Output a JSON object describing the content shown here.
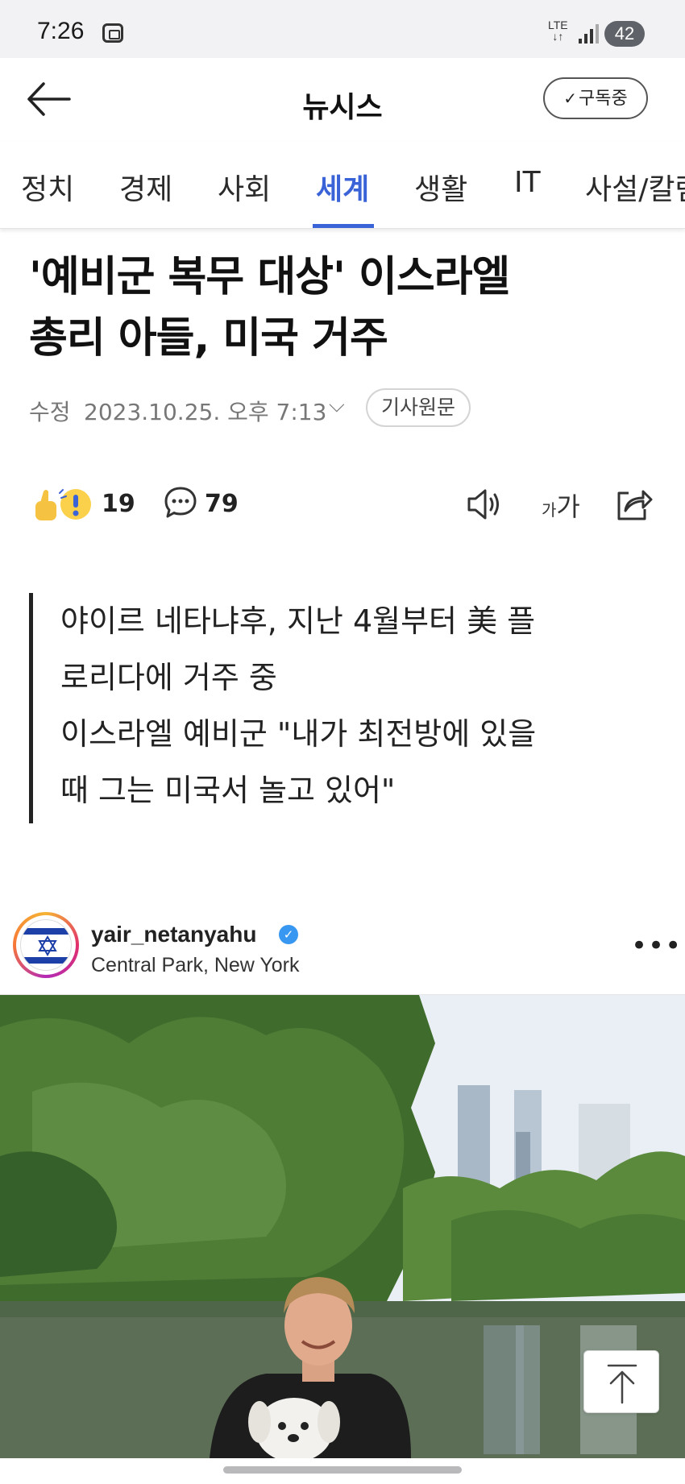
{
  "status_bar": {
    "time": "7:26",
    "network": "LTE",
    "battery": "42"
  },
  "header": {
    "title": "뉴시스",
    "subscribe_label": "구독중"
  },
  "tabs": [
    {
      "label": "정치"
    },
    {
      "label": "경제"
    },
    {
      "label": "사회"
    },
    {
      "label": "세계",
      "active": true
    },
    {
      "label": "생활"
    },
    {
      "label": "IT"
    },
    {
      "label": "사설/칼럼"
    }
  ],
  "article": {
    "headline_line1": "'예비군 복무 대상' 이스라엘",
    "headline_line2": "총리 아들, 미국 거주",
    "meta_label": "수정",
    "date": "2023.10.25. 오후 7:13",
    "original_label": "기사원문",
    "reaction_count": "19",
    "comment_count": "79",
    "fontsize_small": "가",
    "fontsize_large": "가",
    "summary_lines": [
      "야이르 네타냐후, 지난 4월부터 美 플",
      "로리다에 거주 중",
      "이스라엘 예비군 \"내가 최전방에 있을",
      "때 그는 미국서 놀고 있어\""
    ]
  },
  "instagram_post": {
    "username": "yair_netanyahu",
    "location": "Central Park, New York"
  },
  "colors": {
    "accent": "#3b63d8",
    "verified": "#3897f0"
  }
}
